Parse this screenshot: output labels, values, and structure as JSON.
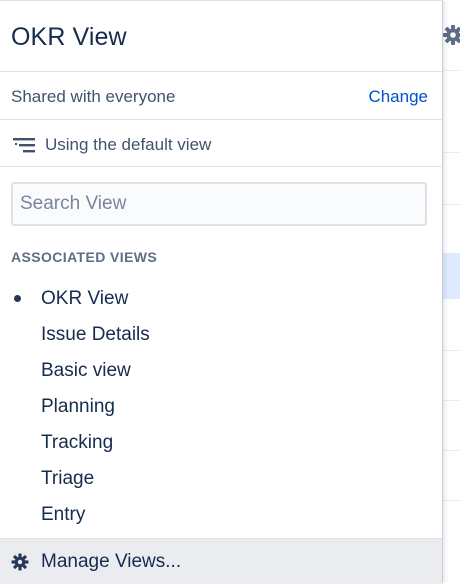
{
  "panel": {
    "title": "OKR View",
    "sharing": {
      "text": "Shared with everyone",
      "change_label": "Change"
    },
    "default_view": {
      "icon": "hierarchy-list-icon",
      "text": "Using the default view"
    },
    "search": {
      "placeholder": "Search View",
      "value": ""
    },
    "section_label": "ASSOCIATED VIEWS",
    "views": [
      {
        "label": "OKR View",
        "selected": true
      },
      {
        "label": "Issue Details",
        "selected": false
      },
      {
        "label": "Basic view",
        "selected": false
      },
      {
        "label": "Planning",
        "selected": false
      },
      {
        "label": "Tracking",
        "selected": false
      },
      {
        "label": "Triage",
        "selected": false
      },
      {
        "label": "Entry",
        "selected": false
      }
    ],
    "footer": {
      "icon": "gear-icon",
      "label": "Manage Views..."
    }
  },
  "colors": {
    "link": "#0052cc",
    "text": "#172b4d",
    "muted": "#42526e",
    "footer_bg": "#ebecf0",
    "selected_row_bg": "#deebff"
  }
}
